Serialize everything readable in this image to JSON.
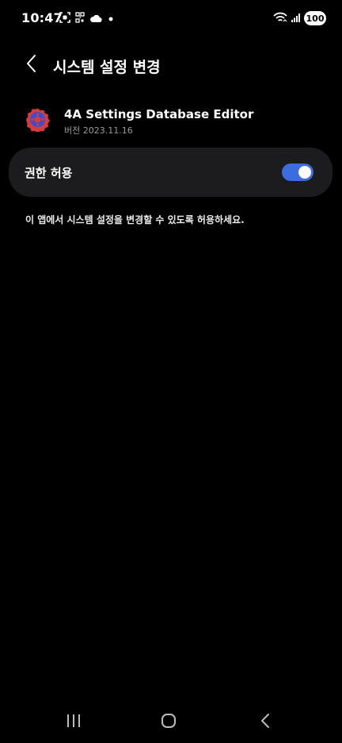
{
  "status_bar": {
    "time": "10:47",
    "battery": "100",
    "left_icons": [
      "screenshot-icon",
      "qr-scan-icon",
      "cloud-icon",
      "notification-dot-icon"
    ],
    "right_icons": [
      "wifi-icon",
      "signal-icon"
    ]
  },
  "header": {
    "title": "시스템 설정 변경"
  },
  "app": {
    "name": "4A Settings Database Editor",
    "version": "버전 2023.11.16"
  },
  "permission": {
    "label": "권한 허용",
    "enabled": true
  },
  "description": "이 앱에서 시스템 설정을 변경할 수 있도록 허용하세요.",
  "nav_bar": {
    "buttons": [
      "recents-icon",
      "home-icon",
      "back-icon"
    ]
  },
  "colors": {
    "background": "#000000",
    "card": "#1c1c1e",
    "toggle_on": "#3d6be0",
    "secondary_text": "#9a9a9a"
  }
}
